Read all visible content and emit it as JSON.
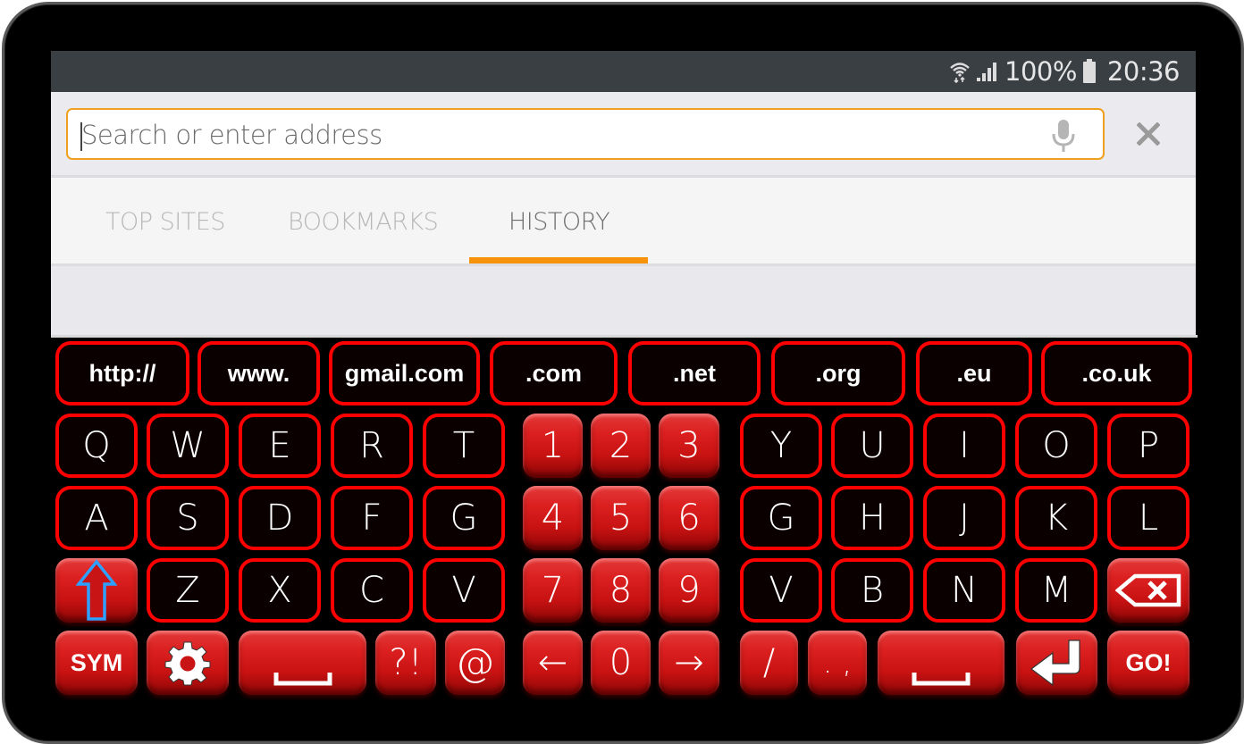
{
  "status_bar": {
    "battery": "100%",
    "time": "20:36",
    "icons": [
      "wifi-data-icon",
      "signal-icon",
      "battery-icon"
    ]
  },
  "url_bar": {
    "placeholder": "Search or enter address",
    "value": "",
    "mic_icon": "microphone-icon",
    "close_icon": "close-icon",
    "accent_color": "#f0a020"
  },
  "tabs": {
    "items": [
      {
        "label": "TOP SITES",
        "active": false
      },
      {
        "label": "BOOKMARKS",
        "active": false
      },
      {
        "label": "HISTORY",
        "active": true
      }
    ],
    "indicator_color": "#f7930a"
  },
  "keyboard": {
    "theme_color": "#ff0000",
    "suggestions": [
      "http://",
      "www.",
      "gmail.com",
      ".com",
      ".net",
      ".org",
      ".eu",
      ".co.uk"
    ],
    "row1": {
      "left": [
        "Q",
        "W",
        "E",
        "R",
        "T"
      ],
      "numbers": [
        "1",
        "2",
        "3"
      ],
      "right": [
        "Y",
        "U",
        "I",
        "O",
        "P"
      ]
    },
    "row2": {
      "left": [
        "A",
        "S",
        "D",
        "F",
        "G"
      ],
      "numbers": [
        "4",
        "5",
        "6"
      ],
      "right": [
        "G",
        "H",
        "J",
        "K",
        "L"
      ]
    },
    "row3": {
      "shift_icon": "shift-arrow-icon",
      "left": [
        "Z",
        "X",
        "C",
        "V"
      ],
      "numbers": [
        "7",
        "8",
        "9"
      ],
      "right": [
        "V",
        "B",
        "N",
        "M"
      ],
      "backspace_icon": "backspace-icon"
    },
    "row4": {
      "sym_label": "SYM",
      "settings_icon": "gear-icon",
      "space_icon": "space-bar-icon",
      "punct1": "?!",
      "at": "@",
      "left_arrow": "←",
      "zero": "0",
      "right_arrow": "→",
      "slash": "/",
      "period_comma": ". ,",
      "enter_icon": "enter-icon",
      "go_label": "GO!"
    }
  }
}
